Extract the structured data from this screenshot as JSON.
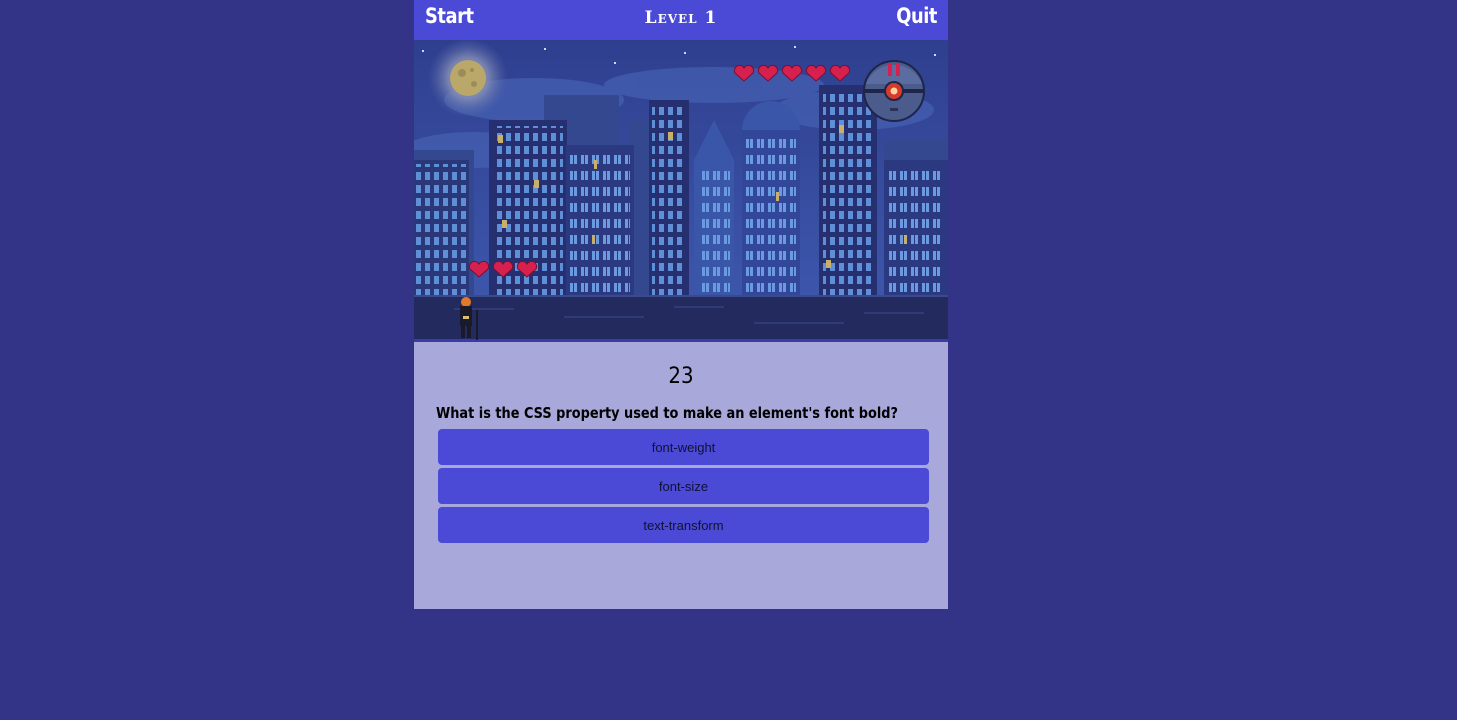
{
  "topbar": {
    "start_label": "Start",
    "level_label": "Level 1",
    "quit_label": "Quit"
  },
  "hud": {
    "player_hearts": 3,
    "enemy_hearts": 5
  },
  "quiz": {
    "timer": "23",
    "question": "What is the CSS property used to make an element's font bold?",
    "answers": [
      "font-weight",
      "font-size",
      "text-transform"
    ]
  },
  "colors": {
    "page_background": "#333388",
    "topbar": "#4a4ad6",
    "quiz_panel": "#a8a8da",
    "answer_button": "#4a4ad6",
    "heart": "#d6204e"
  }
}
